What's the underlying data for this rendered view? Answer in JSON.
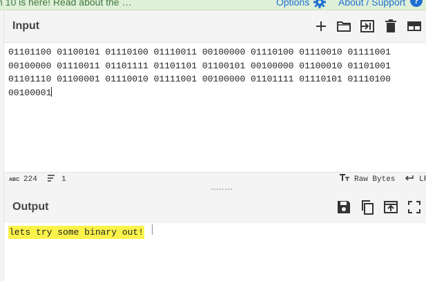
{
  "banner": {
    "text": "n 10 is here! Read about the …",
    "options_label": "Options",
    "about_label": "About / Support",
    "help_glyph": "?"
  },
  "input": {
    "title": "Input",
    "lines": [
      "01101100 01100101 01110100 01110011 00100000 01110100 01110010 01111001",
      "00100000 01110011 01101111 01101101 01100101 00100000 01100010 01101001",
      "01101110 01100001 01110010 01111001 00100000 01101111 01110101 01110100",
      "00100001"
    ],
    "icons": [
      "plus-icon",
      "folder-icon",
      "import-icon",
      "trash-icon",
      "layout-icon"
    ]
  },
  "status": {
    "length_icon_text": "ABC",
    "length": "224",
    "lines": "1",
    "format_label": "Raw Bytes",
    "eol_label": "LF"
  },
  "output": {
    "title": "Output",
    "value": "lets try some binary out!",
    "icons": [
      "save-icon",
      "copy-icon",
      "replace-input-icon",
      "maximize-icon"
    ]
  },
  "colors": {
    "accent": "#1e6fd0",
    "banner_bg": "#dff0d8",
    "highlight": "#fbf34a"
  }
}
